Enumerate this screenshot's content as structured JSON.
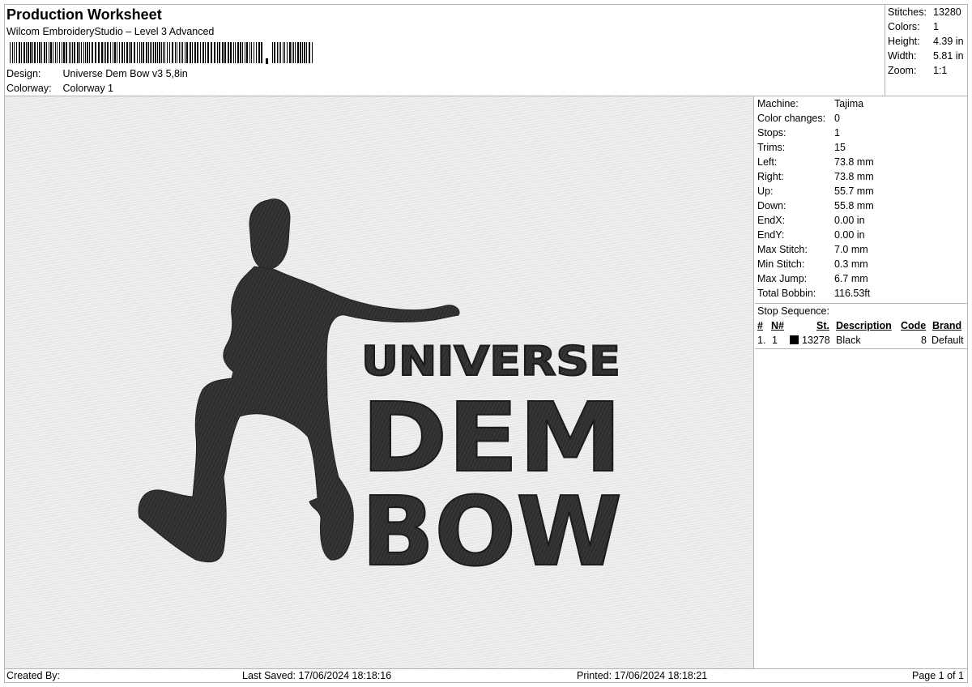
{
  "header": {
    "title": "Production Worksheet",
    "subtitle": "Wilcom EmbroideryStudio – Level 3 Advanced",
    "design_label": "Design:",
    "design_value": "Universe Dem Bow v3 5,8in",
    "colorway_label": "Colorway:",
    "colorway_value": "Colorway 1"
  },
  "summary": [
    {
      "key": "Stitches:",
      "value": "13280"
    },
    {
      "key": "Colors:",
      "value": "1"
    },
    {
      "key": "Height:",
      "value": "4.39 in"
    },
    {
      "key": "Width:",
      "value": "5.81 in"
    },
    {
      "key": "Zoom:",
      "value": "1:1"
    }
  ],
  "machine_info": [
    {
      "key": "Machine:",
      "value": "Tajima"
    },
    {
      "key": "Color changes:",
      "value": "0"
    },
    {
      "key": "Stops:",
      "value": "1"
    },
    {
      "key": "Trims:",
      "value": "15"
    },
    {
      "key": "Left:",
      "value": "73.8 mm"
    },
    {
      "key": "Right:",
      "value": "73.8 mm"
    },
    {
      "key": "Up:",
      "value": "55.7 mm"
    },
    {
      "key": "Down:",
      "value": "55.8 mm"
    },
    {
      "key": "EndX:",
      "value": "0.00 in"
    },
    {
      "key": "EndY:",
      "value": "0.00 in"
    },
    {
      "key": "Max Stitch:",
      "value": "7.0 mm"
    },
    {
      "key": "Min Stitch:",
      "value": "0.3 mm"
    },
    {
      "key": "Max Jump:",
      "value": "6.7 mm"
    },
    {
      "key": "Total Bobbin:",
      "value": "116.53ft"
    }
  ],
  "stop_sequence": {
    "title": "Stop Sequence:",
    "columns": [
      "#",
      "N#",
      "St.",
      "Description",
      "Code",
      "Brand"
    ],
    "rows": [
      {
        "index": "1.",
        "needle": "1",
        "stitches": "13278",
        "description": "Black",
        "code": "8",
        "brand": "Default",
        "color": "#000000"
      }
    ]
  },
  "design_text": {
    "line1": "UNIVERSE",
    "line2": "DEM",
    "line3": "BOW",
    "thread_color": "#2e2f2c"
  },
  "footer": {
    "created_by": "Created By:",
    "last_saved": "Last Saved: 17/06/2024 18:18:16",
    "printed": "Printed: 17/06/2024 18:18:21",
    "page": "Page 1 of 1"
  }
}
